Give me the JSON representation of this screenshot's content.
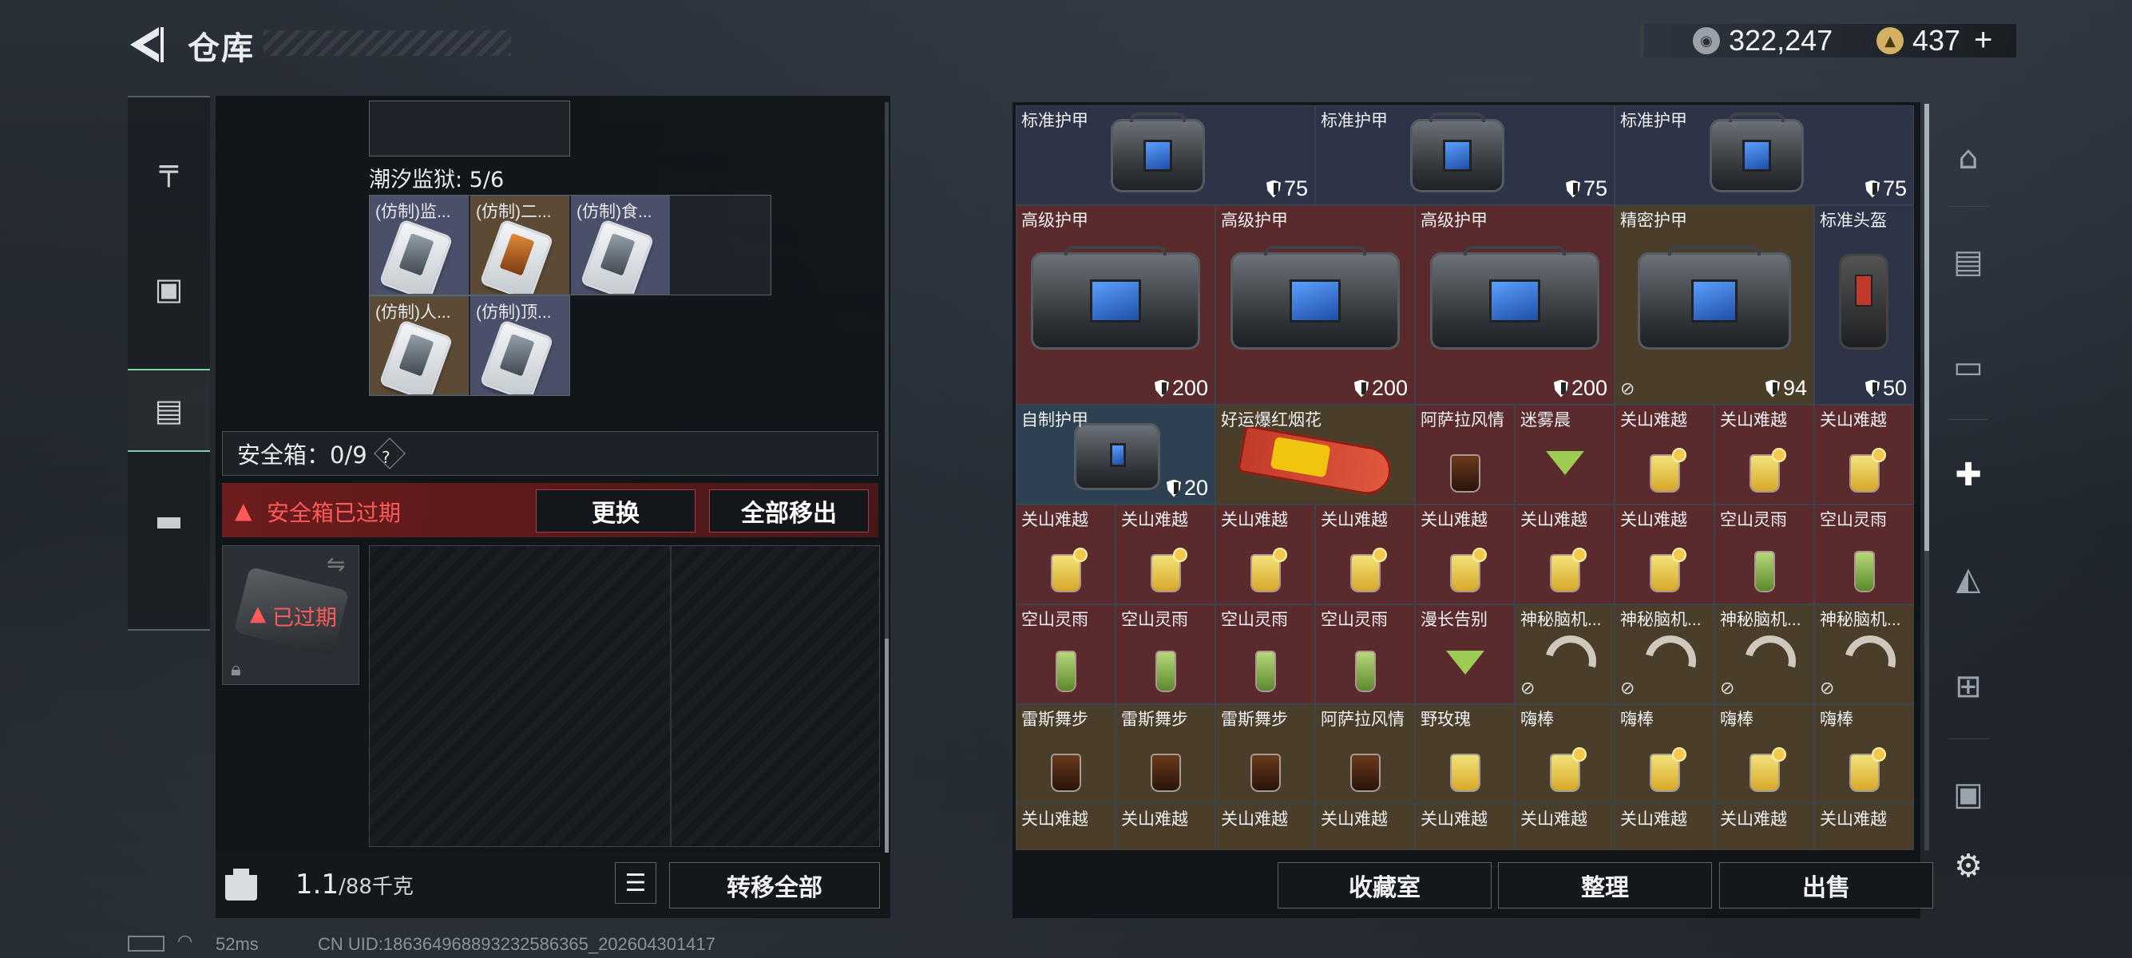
{
  "header": {
    "title": "仓库",
    "currency_silver": "322,247",
    "currency_gold": "437",
    "add_symbol": "+"
  },
  "left_nav": {
    "items": [
      {
        "id": "weapons",
        "icon": "pistol-icon"
      },
      {
        "id": "backpack",
        "icon": "backpack-icon"
      },
      {
        "id": "vest",
        "icon": "vest-icon",
        "active": true
      },
      {
        "id": "case",
        "icon": "briefcase-icon"
      }
    ]
  },
  "left_panel": {
    "collection_title": "潮汐监狱: 5/6",
    "collection_items": [
      "(仿制)监...",
      "(仿制)二...",
      "(仿制)食...",
      "(仿制)人...",
      "(仿制)顶..."
    ],
    "safe_box_label": "安全箱：0/9",
    "help_symbol": "?",
    "warning_text": "安全箱已过期",
    "replace_button": "更换",
    "remove_all_button": "全部移出",
    "expired_text": "已过期",
    "weight_value": "1.1",
    "weight_max": "/88千克",
    "transfer_all_button": "转移全部"
  },
  "grid": {
    "row1": [
      {
        "name": "标准护甲",
        "value": "75"
      },
      {
        "name": "标准护甲",
        "value": "75"
      },
      {
        "name": "标准护甲",
        "value": "75"
      }
    ],
    "row2": [
      {
        "name": "高级护甲",
        "value": "200"
      },
      {
        "name": "高级护甲",
        "value": "200"
      },
      {
        "name": "高级护甲",
        "value": "200"
      },
      {
        "name": "精密护甲",
        "value": "94"
      },
      {
        "name": "标准头盔",
        "value": "50"
      }
    ],
    "row3": [
      {
        "name": "自制护甲",
        "value": "20"
      },
      {
        "name": "好运爆红烟花"
      },
      {
        "name": "阿萨拉风情"
      },
      {
        "name": "迷雾晨"
      },
      {
        "name": "关山难越"
      },
      {
        "name": "关山难越"
      },
      {
        "name": "关山难越"
      }
    ],
    "row4": [
      "关山难越",
      "关山难越",
      "关山难越",
      "关山难越",
      "关山难越",
      "关山难越",
      "关山难越",
      "空山灵雨",
      "空山灵雨"
    ],
    "row5": [
      "空山灵雨",
      "空山灵雨",
      "空山灵雨",
      "空山灵雨",
      "漫长告别",
      "神秘脑机...",
      "神秘脑机...",
      "神秘脑机...",
      "神秘脑机..."
    ],
    "row6": [
      "雷斯舞步",
      "雷斯舞步",
      "雷斯舞步",
      "阿萨拉风情",
      "野玫瑰",
      "嗨棒",
      "嗨棒",
      "嗨棒",
      "嗨棒"
    ],
    "row7": [
      "关山难越",
      "关山难越",
      "关山难越",
      "关山难越",
      "关山难越",
      "关山难越",
      "关山难越",
      "关山难越",
      "关山难越"
    ]
  },
  "bottom_right": {
    "collection_button": "收藏室",
    "sort_button": "整理",
    "sell_button": "出售"
  },
  "right_nav": [
    {
      "icon": "base-icon"
    },
    {
      "icon": "iv-storage-icon"
    },
    {
      "icon": "iv-weapon-icon"
    },
    {
      "icon": "iv-medkit-icon"
    },
    {
      "icon": "iv-throwable-icon"
    },
    {
      "icon": "iv-medkit-plus-icon"
    },
    {
      "icon": "v-device-icon"
    },
    {
      "icon": "settings-icon"
    }
  ],
  "footer": {
    "ping": "52ms",
    "uid": "CN UID:18636496889323258636​5_202604301417"
  }
}
